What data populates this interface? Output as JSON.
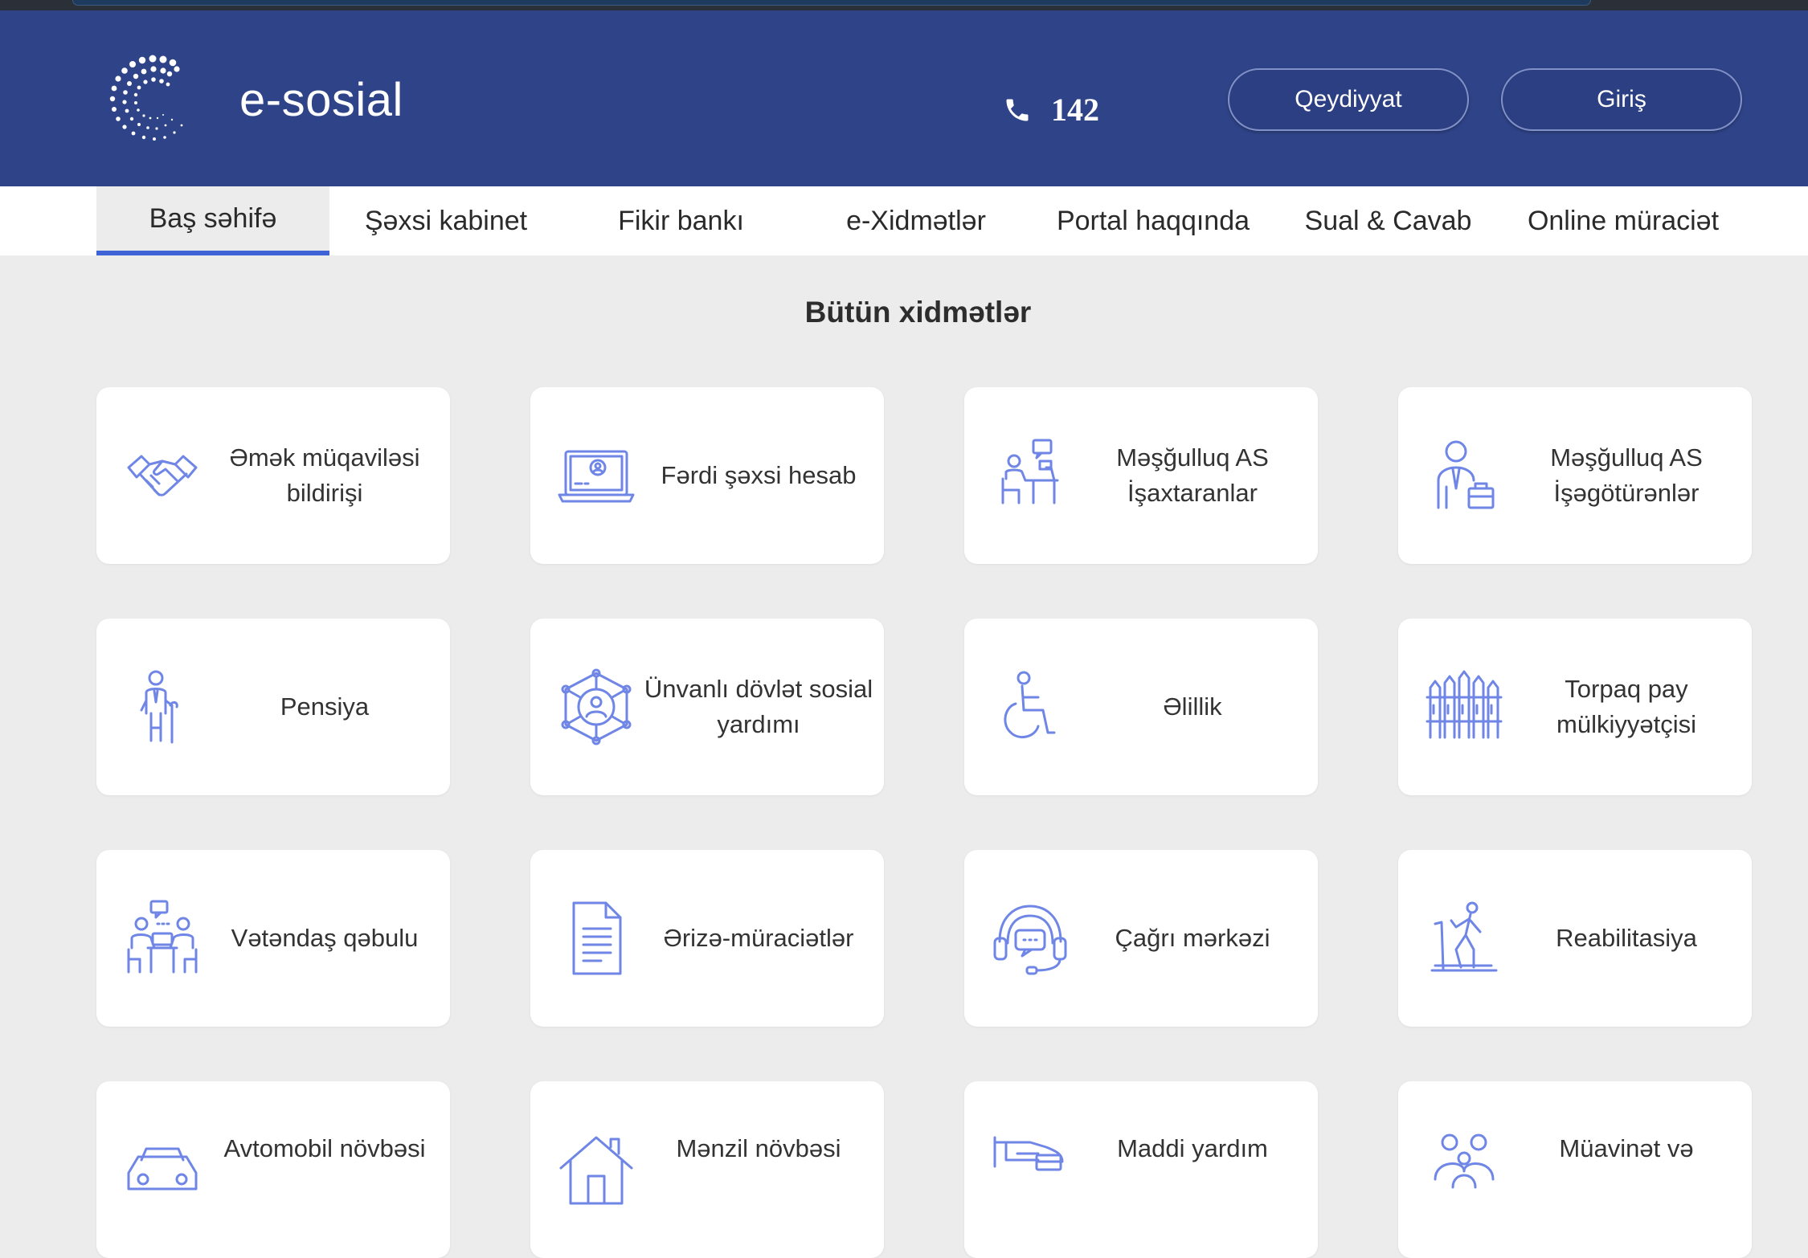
{
  "header": {
    "brand": "e-sosial",
    "phone_number": "142",
    "register_button": "Qeydiyyat",
    "login_button": "Giriş",
    "colors": {
      "header_bg": "#2f4488",
      "accent": "#3e63d6",
      "icon": "#6f86e6"
    }
  },
  "nav": {
    "items": [
      {
        "label": "Baş səhifə",
        "active": true
      },
      {
        "label": "Şəxsi kabinet"
      },
      {
        "label": "Fikir bankı"
      },
      {
        "label": "e-Xidmətlər"
      },
      {
        "label": "Portal haqqında"
      },
      {
        "label": "Sual & Cavab"
      },
      {
        "label": "Online müraciət"
      }
    ]
  },
  "main": {
    "title": "Bütün xidmətlər",
    "services": [
      {
        "label": "Əmək müqaviləsi\nbildirişi",
        "icon": "handshake-icon"
      },
      {
        "label": "Fərdi şəxsi hesab",
        "icon": "laptop-account-icon"
      },
      {
        "label": "Məşğulluq AS\nİşaxtaranlar",
        "icon": "job-seeker-desk-icon"
      },
      {
        "label": "Məşğulluq AS\nİşəgötürənlər",
        "icon": "employer-briefcase-icon"
      },
      {
        "label": "Pensiya",
        "icon": "elderly-person-icon"
      },
      {
        "label": "Ünvanlı dövlət sosial\nyardımı",
        "icon": "social-network-icon"
      },
      {
        "label": "Əlillik",
        "icon": "wheelchair-icon"
      },
      {
        "label": "Torpaq pay\nmülkiyyətçisi",
        "icon": "fence-icon"
      },
      {
        "label": "Vətəndaş qəbulu",
        "icon": "reception-meeting-icon"
      },
      {
        "label": "Ərizə-müraciətlər",
        "icon": "document-icon"
      },
      {
        "label": "Çağrı mərkəzi",
        "icon": "call-center-headset-icon"
      },
      {
        "label": "Reabilitasiya",
        "icon": "rehabilitation-treadmill-icon"
      },
      {
        "label": "Avtomobil növbəsi",
        "icon": "car-icon"
      },
      {
        "label": "Mənzil növbəsi",
        "icon": "house-icon"
      },
      {
        "label": "Maddi yardım",
        "icon": "hand-money-icon"
      },
      {
        "label": "Müavinət və",
        "icon": "family-icon"
      }
    ]
  }
}
